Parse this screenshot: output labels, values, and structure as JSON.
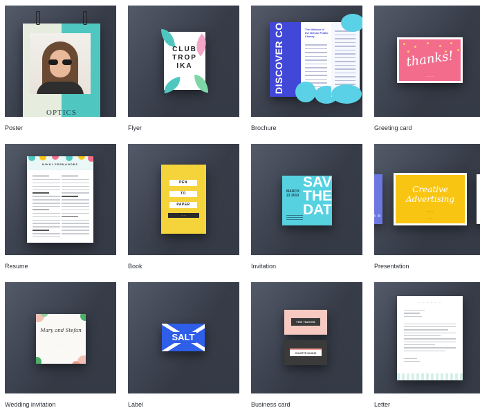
{
  "templates": [
    {
      "label": "Poster",
      "thumb_text": "OPTICS"
    },
    {
      "label": "Flyer",
      "thumb_text": "CLUB\nTROP\nIKA"
    },
    {
      "label": "Brochure",
      "thumb_text": "DISCOVER CONNECT GET INSPIRED",
      "thumb_heading": "The Mission of the Nelson Public Library"
    },
    {
      "label": "Greeting card",
      "thumb_text": "thanks!"
    },
    {
      "label": "Resume",
      "thumb_text": "NIKKI FERNANDEZ"
    },
    {
      "label": "Book",
      "thumb_lines": [
        "PEN",
        "TO",
        "PAPER"
      ]
    },
    {
      "label": "Invitation",
      "thumb_text": "SAVE THE DATE",
      "thumb_side": "MARCH 23 2019"
    },
    {
      "label": "Presentation",
      "thumb_text": "Creative Advertising"
    },
    {
      "label": "Wedding invitation",
      "thumb_text": "Mary and Stefan"
    },
    {
      "label": "Label",
      "thumb_text": "SALT"
    },
    {
      "label": "Business card",
      "thumb_text": "THE HUGHS",
      "thumb_text_2": "COLETTE HUGHS"
    },
    {
      "label": "Letter"
    }
  ],
  "colors": {
    "tile_bg": "#3d4350",
    "caption": "#2a2e36"
  }
}
